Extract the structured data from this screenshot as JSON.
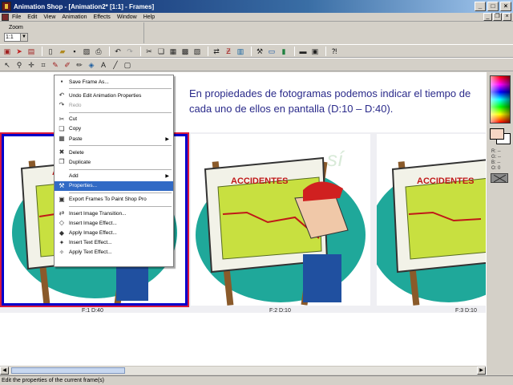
{
  "window": {
    "title": "Animation Shop - [Animation2* [1:1] - Frames]",
    "controls": [
      "_",
      "□",
      "×"
    ]
  },
  "menubar": [
    "File",
    "Edit",
    "View",
    "Animation",
    "Effects",
    "Window",
    "Help"
  ],
  "zoom": {
    "label": "Zoom",
    "value": "1:1"
  },
  "heading": "En propiedades de fotogramas podemos indicar el tiempo de cada uno de ellos en pantalla (D:10 – D:40).",
  "frames": [
    {
      "label": "F:1  D:40",
      "selected": true
    },
    {
      "label": "F:2  D:10",
      "selected": false
    },
    {
      "label": "F:3  D:10",
      "selected": false
    }
  ],
  "frame_art": {
    "chart_title": "ACCIDENTES",
    "stamp": "sí"
  },
  "context_menu": {
    "items": [
      {
        "label": "Save Frame As...",
        "icon": "save-icon"
      },
      {
        "sep": true
      },
      {
        "label": "Undo Edit Animation Properties",
        "icon": "undo-icon"
      },
      {
        "label": "Redo",
        "icon": "redo-icon",
        "disabled": true
      },
      {
        "sep": true
      },
      {
        "label": "Cut",
        "icon": "cut-icon"
      },
      {
        "label": "Copy",
        "icon": "copy-icon"
      },
      {
        "label": "Paste",
        "icon": "paste-icon",
        "submenu": true
      },
      {
        "sep": true
      },
      {
        "label": "Delete",
        "icon": "delete-icon"
      },
      {
        "label": "Duplicate",
        "icon": "duplicate-icon"
      },
      {
        "sep": true
      },
      {
        "label": "Add",
        "icon": "add-icon",
        "submenu": true
      },
      {
        "label": "Properties...",
        "icon": "properties-icon",
        "highlighted": true
      },
      {
        "sep": true
      },
      {
        "label": "Export Frames To Paint Shop Pro",
        "icon": "export-icon"
      },
      {
        "sep": true
      },
      {
        "label": "Insert Image Transition...",
        "icon": "transition-icon"
      },
      {
        "label": "Insert Image Effect...",
        "icon": "image-effect-icon"
      },
      {
        "label": "Apply Image Effect...",
        "icon": "apply-image-effect-icon"
      },
      {
        "label": "Insert Text Effect...",
        "icon": "text-effect-icon"
      },
      {
        "label": "Apply Text Effect...",
        "icon": "apply-text-effect-icon"
      }
    ]
  },
  "palette": {
    "readout": [
      "R: --",
      "G: --",
      "B: --",
      "O: 0"
    ],
    "fg_color": "#f6d6c4",
    "bg_color": "#ffffff"
  },
  "status": "Edit the properties of the current frame(s)",
  "colors": {
    "title_bar": "#0a246a",
    "selection_border": "#0000cc",
    "menu_highlight": "#316ac5",
    "heading_text": "#2a2a8a"
  }
}
